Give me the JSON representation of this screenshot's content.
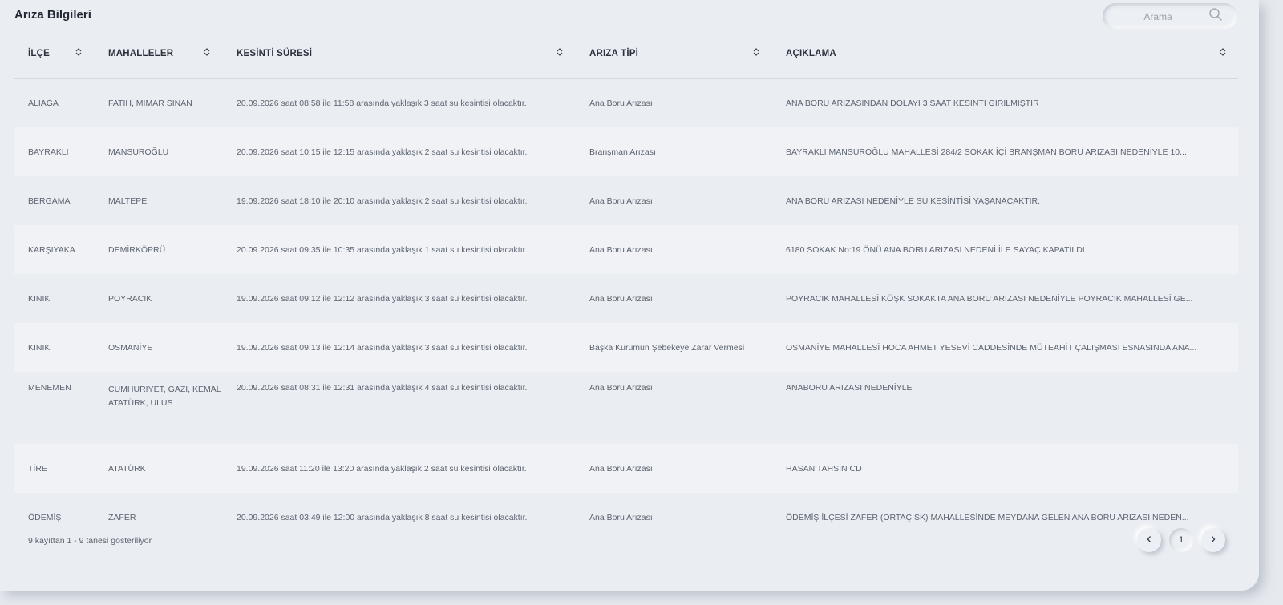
{
  "header": {
    "title": "Arıza Bilgileri"
  },
  "search": {
    "placeholder": "Arama",
    "icon": "search-icon"
  },
  "table": {
    "columns": [
      "İLÇE",
      "MAHALLELER",
      "KESİNTİ SÜRESİ",
      "ARIZA TİPİ",
      "AÇIKLAMA"
    ],
    "rows": [
      [
        "ALİAĞA",
        "FATİH, MİMAR SİNAN",
        "20.09.2026 saat 08:58 ile 11:58 arasında yaklaşık 3 saat su kesintisi olacaktır.",
        "Ana Boru Arızası",
        "ANA BORU ARIZASINDAN DOLAYI 3 SAAT KESINTI GIRILMIŞTIR"
      ],
      [
        "BAYRAKLI",
        "MANSUROĞLU",
        "20.09.2026 saat 10:15 ile 12:15 arasında yaklaşık 2 saat su kesintisi olacaktır.",
        "Branşman Arızası",
        "BAYRAKLI MANSUROĞLU MAHALLESİ 284/2 SOKAK İÇİ BRANŞMAN BORU ARIZASI NEDENİYLE 10..."
      ],
      [
        "BERGAMA",
        "MALTEPE",
        "19.09.2026 saat 18:10 ile 20:10 arasında yaklaşık 2 saat su kesintisi olacaktır.",
        "Ana Boru Arızası",
        "ANA BORU ARIZASI NEDENİYLE SU KESİNTİSİ YAŞANACAKTIR."
      ],
      [
        "KARŞIYAKA",
        "DEMİRKÖPRÜ",
        "20.09.2026 saat 09:35 ile 10:35 arasında yaklaşık 1 saat su kesintisi olacaktır.",
        "Ana Boru Arızası",
        "6180 SOKAK No:19 ÖNÜ ANA BORU ARIZASI NEDENİ İLE SAYAÇ KAPATILDI."
      ],
      [
        "KINIK",
        "POYRACIK",
        "19.09.2026 saat 09:12 ile 12:12 arasında yaklaşık 3 saat su kesintisi olacaktır.",
        "Ana Boru Arızası",
        "POYRACIK MAHALLESİ KÖŞK SOKAKTA ANA BORU ARIZASI NEDENİYLE POYRACIK MAHALLESİ GE..."
      ],
      [
        "KINIK",
        "OSMANİYE",
        "19.09.2026 saat 09:13 ile 12:14 arasında yaklaşık 3 saat su kesintisi olacaktır.",
        "Başka Kurumun Şebekeye Zarar Vermesi",
        "OSMANİYE MAHALLESİ HOCA AHMET YESEVİ CADDESİNDE MÜTEAHİT ÇALIŞMASI ESNASINDA ANA..."
      ],
      [
        "MENEMEN",
        "CUMHURİYET, GAZİ, KEMAL ATATÜRK, ULUS",
        "20.09.2026 saat 08:31 ile 12:31 arasında yaklaşık 4 saat su kesintisi olacaktır.",
        "Ana Boru Arızası",
        "ANABORU ARIZASI NEDENİYLE"
      ],
      [
        "TİRE",
        "ATATÜRK",
        "19.09.2026 saat 11:20 ile 13:20 arasında yaklaşık 2 saat su kesintisi olacaktır.",
        "Ana Boru Arızası",
        "HASAN TAHSİN CD"
      ],
      [
        "ÖDEMİŞ",
        "ZAFER",
        "20.09.2026 saat 03:49 ile 12:00 arasında yaklaşık 8 saat su kesintisi olacaktır.",
        "Ana Boru Arızası",
        "ÖDEMİŞ İLÇESİ ZAFER (ORTAÇ SK) MAHALLESİNDE MEYDANA GELEN ANA BORU ARIZASI NEDEN..."
      ]
    ]
  },
  "footer": {
    "info": "9 kayıttan 1 - 9 tanesi gösteriliyor",
    "current_page": "1",
    "prev_icon": "chevron-left-icon",
    "next_icon": "chevron-right-icon"
  }
}
